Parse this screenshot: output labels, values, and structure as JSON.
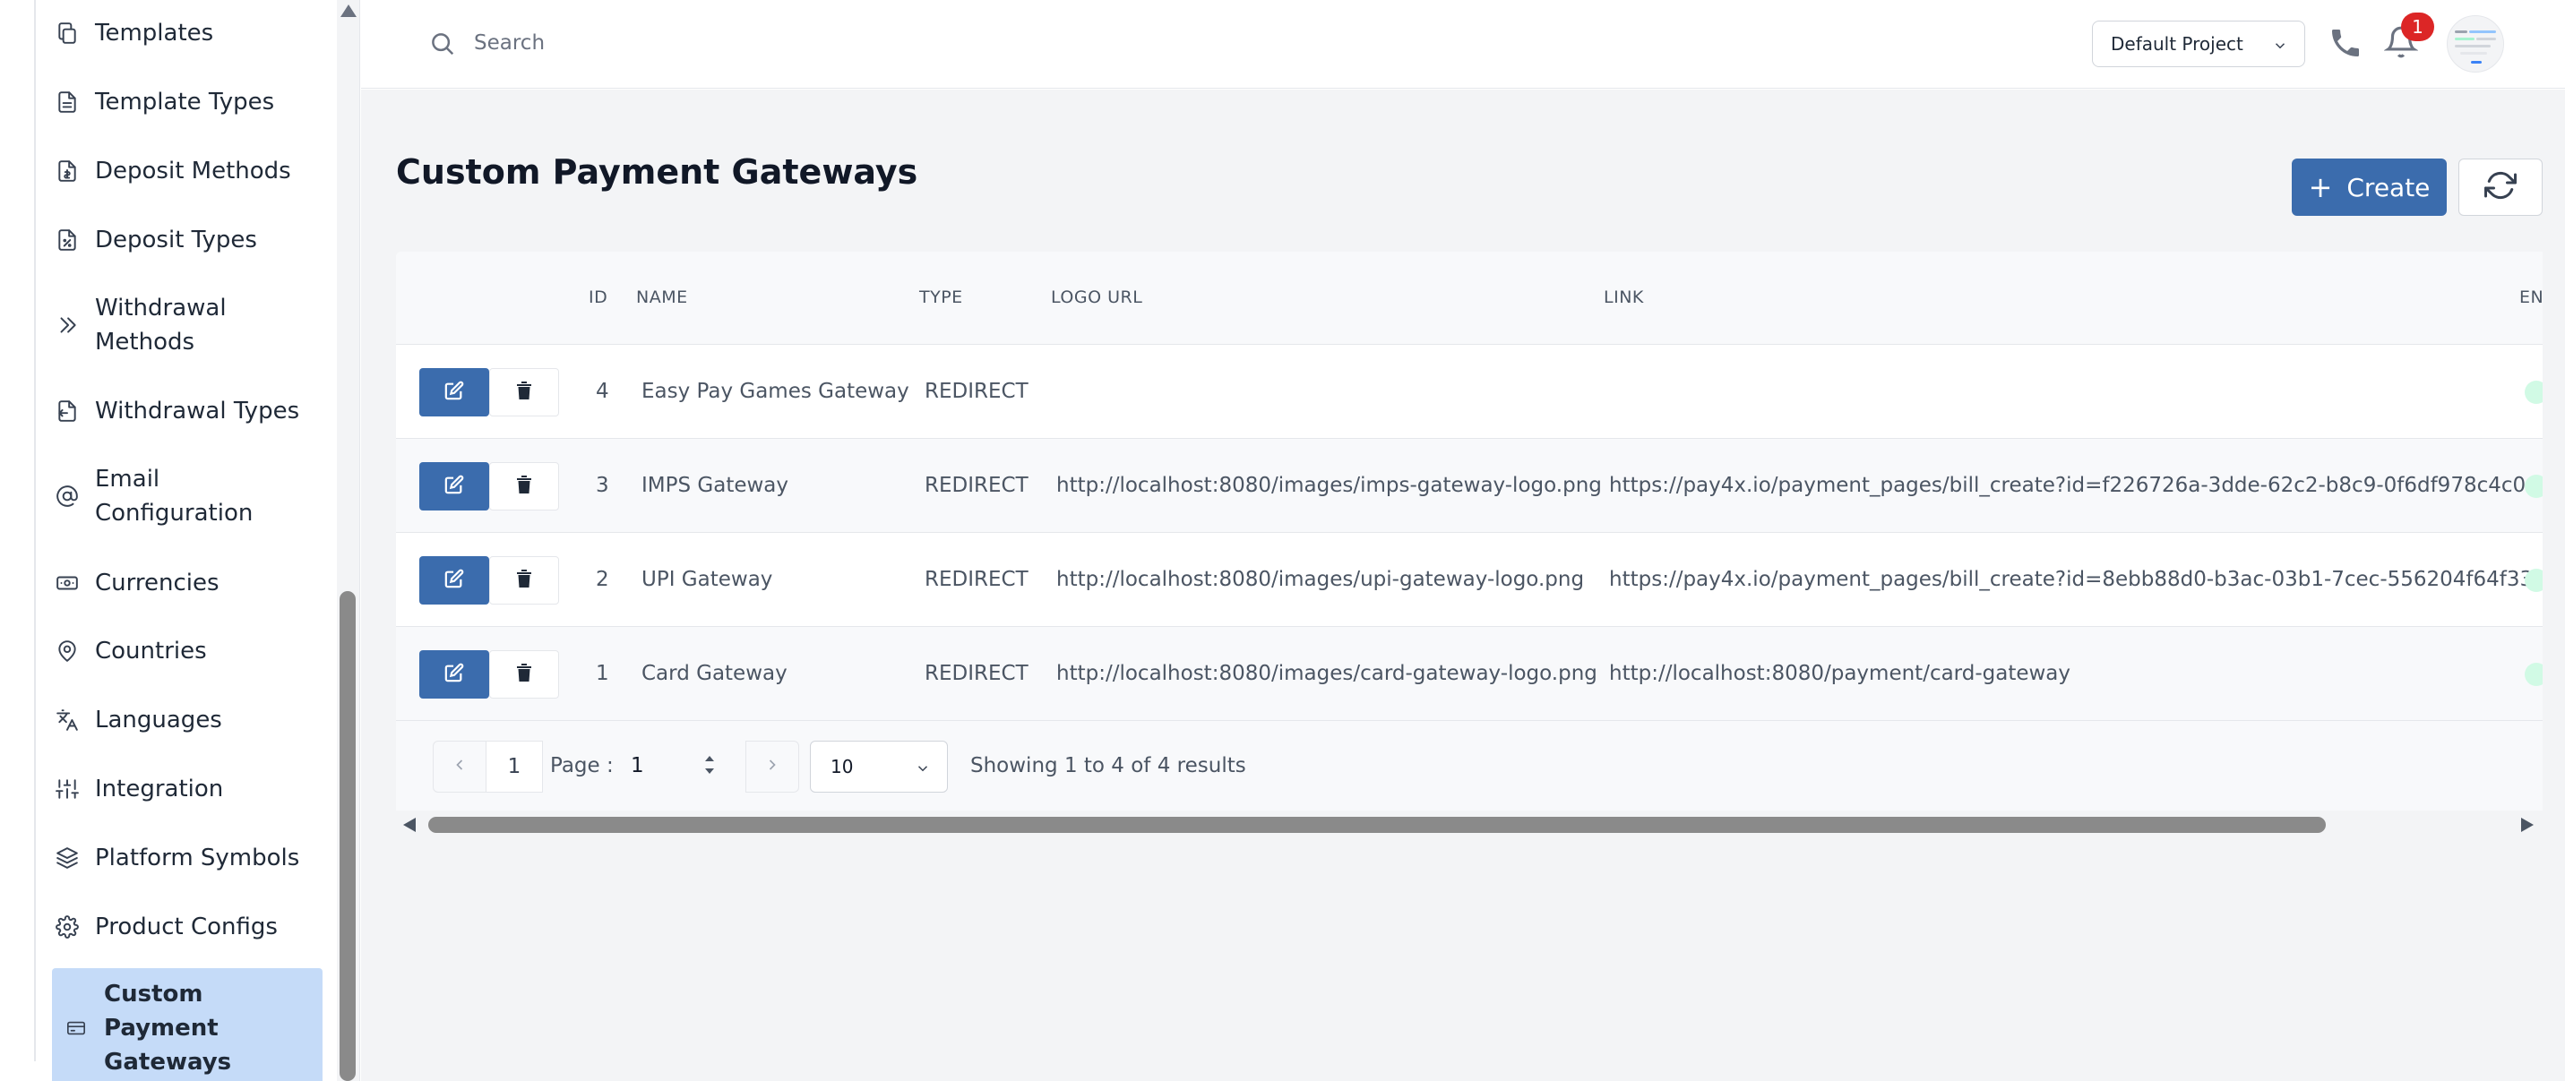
{
  "sidebar": {
    "items": [
      {
        "label": "Templates",
        "icon": "copy-icon"
      },
      {
        "label": "Template Types",
        "icon": "file-text-icon"
      },
      {
        "label": "Deposit Methods",
        "icon": "file-dollar-icon"
      },
      {
        "label": "Deposit Types",
        "icon": "file-percent-icon"
      },
      {
        "label": "Withdrawal Methods",
        "icon": "chevrons-right-icon"
      },
      {
        "label": "Withdrawal Types",
        "icon": "file-export-icon"
      },
      {
        "label": "Email Configuration",
        "icon": "at-sign-icon"
      },
      {
        "label": "Currencies",
        "icon": "banknote-icon"
      },
      {
        "label": "Countries",
        "icon": "map-pin-icon"
      },
      {
        "label": "Languages",
        "icon": "languages-icon"
      },
      {
        "label": "Integration",
        "icon": "sliders-icon"
      },
      {
        "label": "Platform Symbols",
        "icon": "layers-icon"
      },
      {
        "label": "Product Configs",
        "icon": "settings-icon"
      },
      {
        "label": "Custom Payment Gateways",
        "icon": "credit-card-icon",
        "active": true
      }
    ]
  },
  "topbar": {
    "search_placeholder": "Search",
    "project": "Default Project",
    "notification_count": "1"
  },
  "page": {
    "title": "Custom Payment Gateways",
    "create_label": "Create"
  },
  "table": {
    "columns": [
      "ID",
      "NAME",
      "TYPE",
      "LOGO URL",
      "LINK",
      "EN"
    ],
    "rows": [
      {
        "id": "4",
        "name": "Easy Pay Games Gateway",
        "type": "REDIRECT",
        "logo_url": "",
        "link": ""
      },
      {
        "id": "3",
        "name": "IMPS Gateway",
        "type": "REDIRECT",
        "logo_url": "http://localhost:8080/images/imps-gateway-logo.png",
        "link": "https://pay4x.io/payment_pages/bill_create?id=f226726a-3dde-62c2-b8c9-0f6df978c4c0"
      },
      {
        "id": "2",
        "name": "UPI Gateway",
        "type": "REDIRECT",
        "logo_url": "http://localhost:8080/images/upi-gateway-logo.png",
        "link": "https://pay4x.io/payment_pages/bill_create?id=8ebb88d0-b3ac-03b1-7cec-556204f64f33"
      },
      {
        "id": "1",
        "name": "Card Gateway",
        "type": "REDIRECT",
        "logo_url": "http://localhost:8080/images/card-gateway-logo.png",
        "link": "http://localhost:8080/payment/card-gateway"
      }
    ]
  },
  "pagination": {
    "current_page": "1",
    "page_label": "Page :",
    "page_input": "1",
    "page_size": "10",
    "summary": "Showing 1 to 4 of 4 results"
  },
  "colors": {
    "primary": "#3b6cad",
    "active_nav": "#c5dbf8",
    "badge": "#dc2626"
  }
}
